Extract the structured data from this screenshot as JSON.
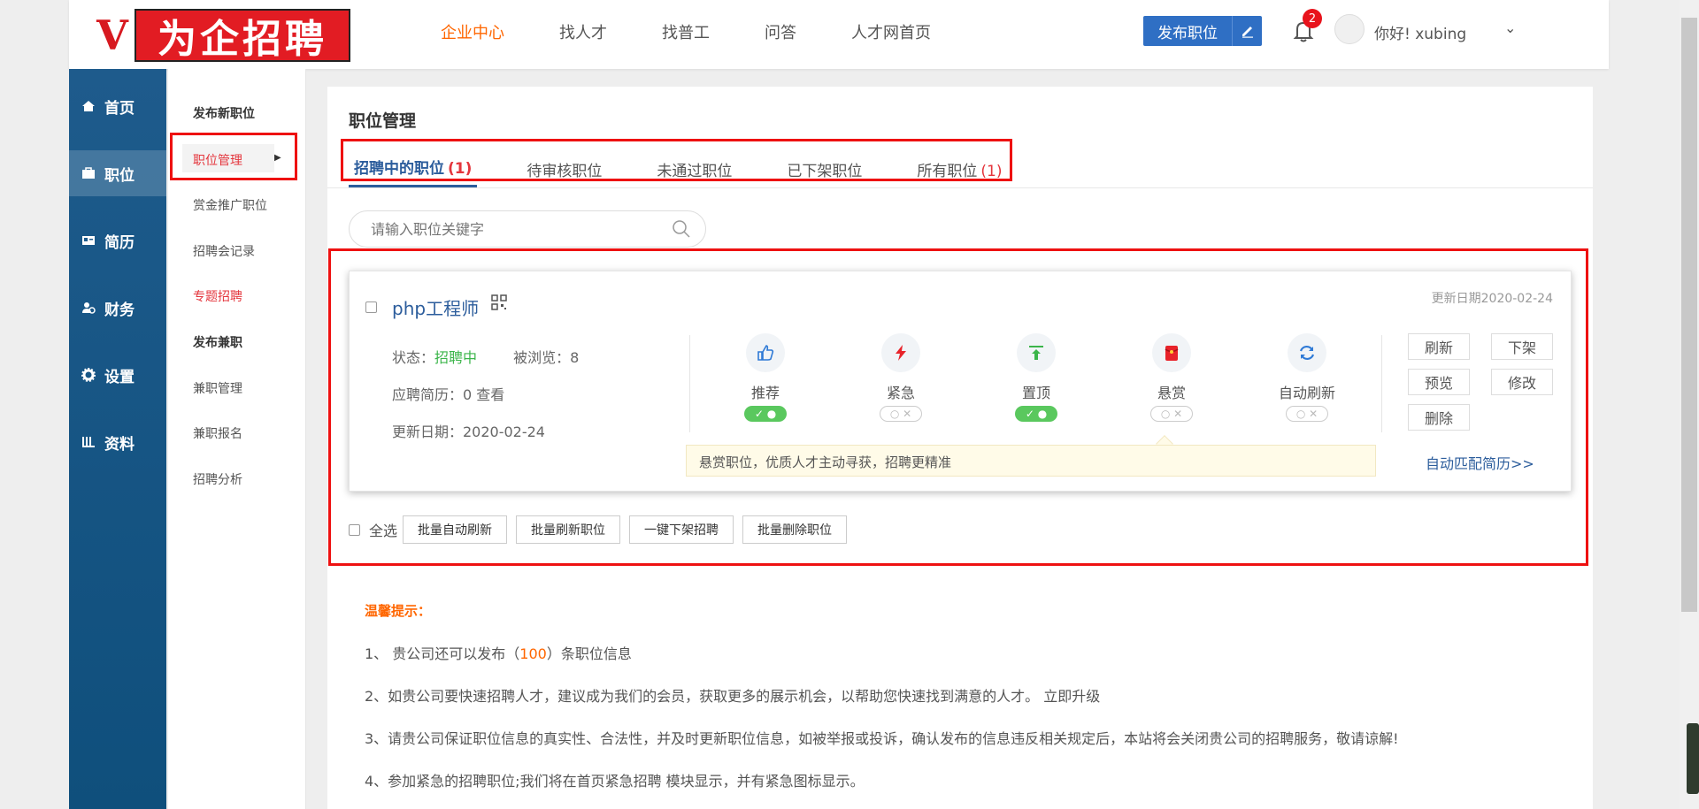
{
  "logo": {
    "v": "V",
    "text": "为企招聘"
  },
  "topnav": {
    "items": [
      "企业中心",
      "找人才",
      "找普工",
      "问答",
      "人才网首页"
    ]
  },
  "header": {
    "publish_label": "发布职位",
    "notif_count": "2",
    "greeting": "你好! xubing"
  },
  "sidebar1": {
    "items": [
      "首页",
      "职位",
      "简历",
      "财务",
      "设置",
      "资料"
    ]
  },
  "sidebar2": {
    "items": [
      "发布新职位",
      "职位管理",
      "赏金推广职位",
      "招聘会记录",
      "专题招聘",
      "发布兼职",
      "兼职管理",
      "兼职报名",
      "招聘分析"
    ]
  },
  "main": {
    "title": "职位管理",
    "tabs": [
      {
        "label": "招聘中的职位",
        "count": "(1)"
      },
      {
        "label": "待审核职位",
        "count": ""
      },
      {
        "label": "未通过职位",
        "count": ""
      },
      {
        "label": "已下架职位",
        "count": ""
      },
      {
        "label": "所有职位",
        "count": "(1)"
      }
    ],
    "search_placeholder": "请输入职位关键字"
  },
  "job": {
    "title": "php工程师",
    "update_date_label": "更新日期2020-02-24",
    "status_label": "状态：",
    "status_value": "招聘中",
    "views": "被浏览：8",
    "resumes": "应聘简历：0 查看",
    "updated": "更新日期：2020-02-24",
    "features": [
      {
        "label": "推荐",
        "icon": "thumb-up-icon",
        "on": true
      },
      {
        "label": "紧急",
        "icon": "lightning-icon",
        "on": false
      },
      {
        "label": "置顶",
        "icon": "pin-top-icon",
        "on": true
      },
      {
        "label": "悬赏",
        "icon": "red-envelope-icon",
        "on": false
      },
      {
        "label": "自动刷新",
        "icon": "refresh-icon",
        "on": false
      }
    ],
    "tip": "悬赏职位，优质人才主动寻获，招聘更精准",
    "actions": [
      "刷新",
      "下架",
      "预览",
      "修改",
      "删除"
    ],
    "auto_match": "自动匹配简历>>"
  },
  "batch": {
    "select_all": "全选",
    "buttons": [
      "批量自动刷新",
      "批量刷新职位",
      "一键下架招聘",
      "批量删除职位"
    ]
  },
  "tips": {
    "title": "温馨提示：",
    "line1_pre": "1、 贵公司还可以发布（",
    "line1_num": "100",
    "line1_post": "）条职位信息",
    "line2": "2、如贵公司要快速招聘人才，建议成为我们的会员，获取更多的展示机会，以帮助您快速找到满意的人才。 立即升级",
    "line3": "3、请贵公司保证职位信息的真实性、合法性，并及时更新职位信息，如被举报或投诉，确认发布的信息违反相关规定后，本站将会关闭贵公司的招聘服务，敬请谅解!",
    "line4": "4、参加紧急的招聘职位;我们将在首页紧急招聘 模块显示，并有紧急图标显示。"
  },
  "colors": {
    "accent": "#2c5d9c",
    "orange": "#ff6600",
    "red": "#e4353c",
    "sidebar": "#1e5b8c"
  }
}
